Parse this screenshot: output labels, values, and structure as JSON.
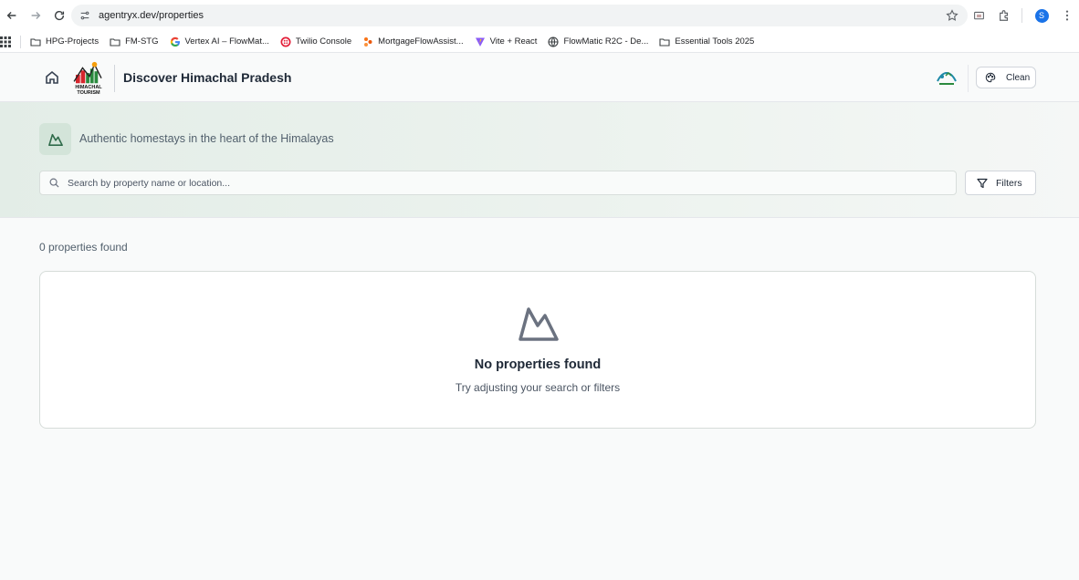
{
  "browser": {
    "url": "agentryx.dev/properties",
    "profile_initial": "S",
    "bookmarks": [
      {
        "label": "HPG-Projects",
        "icon": "folder-icon"
      },
      {
        "label": "FM-STG",
        "icon": "folder-icon"
      },
      {
        "label": "Vertex AI – FlowMat...",
        "icon": "google-icon"
      },
      {
        "label": "Twilio Console",
        "icon": "twilio-icon"
      },
      {
        "label": "MortgageFlowAssist...",
        "icon": "app-icon"
      },
      {
        "label": "Vite + React",
        "icon": "vite-icon"
      },
      {
        "label": "FlowMatic R2C - De...",
        "icon": "globe-icon"
      },
      {
        "label": "Essential Tools 2025",
        "icon": "folder-icon"
      }
    ]
  },
  "header": {
    "logo_text_line1": "HIMACHAL",
    "logo_text_line2": "TOURISM",
    "title": "Discover Himachal Pradesh",
    "theme_button_label": "Clean"
  },
  "hero": {
    "tagline": "Authentic homestays in the heart of the Himalayas",
    "search_placeholder": "Search by property name or location...",
    "filters_label": "Filters"
  },
  "results": {
    "count_text": "0 properties found",
    "empty_title": "No properties found",
    "empty_subtitle": "Try adjusting your search or filters"
  },
  "colors": {
    "accent": "#2f6b4a",
    "hero_bg": "#e3ede7",
    "profile": "#1a73e8"
  }
}
